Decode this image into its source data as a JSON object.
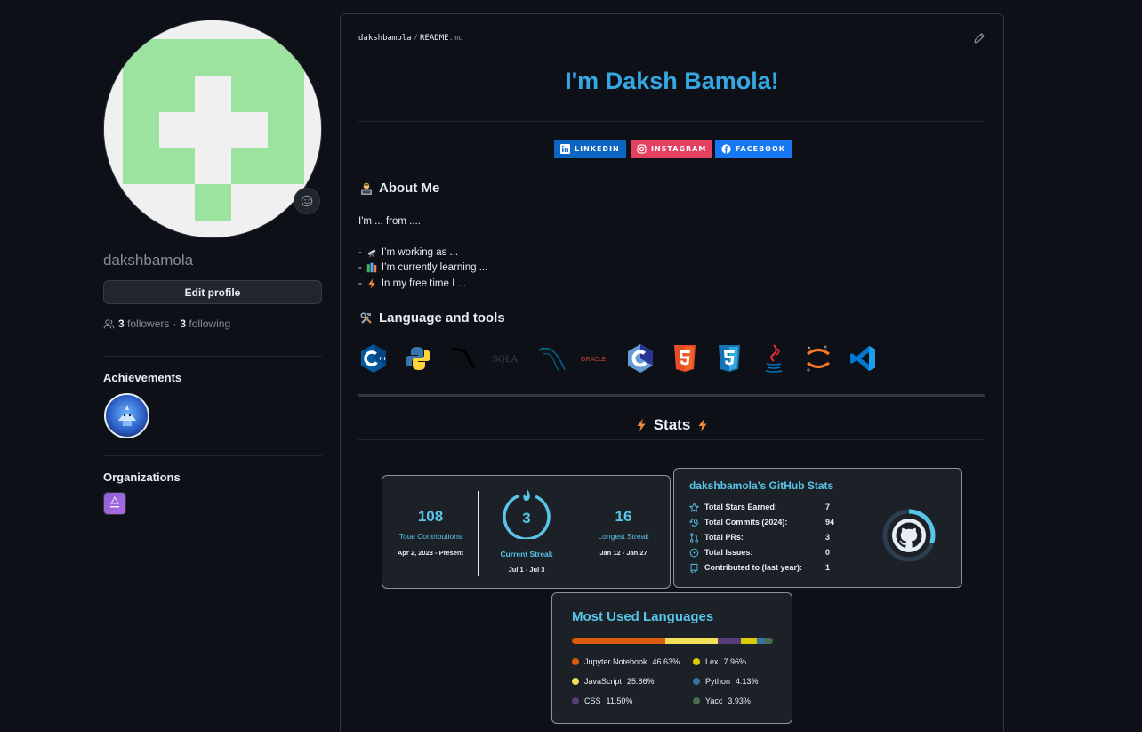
{
  "profile": {
    "username": "dakshbamola",
    "edit_label": "Edit profile",
    "followers_count": "3",
    "followers_label": "followers",
    "separator": "·",
    "following_count": "3",
    "following_label": "following",
    "achievements_heading": "Achievements",
    "organizations_heading": "Organizations"
  },
  "readme": {
    "path_user": "dakshbamola",
    "path_sep": "/",
    "path_file": "README",
    "path_ext": ".md",
    "title": "I'm Daksh Bamola!",
    "social": [
      {
        "label": "LINKEDIN",
        "color": "#0a66c2",
        "icon": "linkedin-icon"
      },
      {
        "label": "INSTAGRAM",
        "color": "#e4405f",
        "icon": "instagram-icon"
      },
      {
        "label": "FACEBOOK",
        "color": "#1877f2",
        "icon": "facebook-icon"
      }
    ],
    "about_heading": "About Me",
    "about_intro": "I'm ... from ....",
    "about_lines": [
      {
        "prefix": "-",
        "text": "I’m working as ...",
        "icon": "telescope-icon"
      },
      {
        "prefix": "-",
        "text": "I’m currently learning ...",
        "icon": "books-icon"
      },
      {
        "prefix": "-",
        "text": "In my free time I ...",
        "icon": "lightning-icon"
      }
    ],
    "tools_heading": "Language and tools",
    "tools": [
      "cplusplus-icon",
      "python-icon",
      "tensorflow-icon",
      "sqlite-icon",
      "mysql-icon",
      "oracle-icon",
      "c-icon",
      "html5-icon",
      "css3-icon",
      "java-icon",
      "jupyter-icon",
      "vscode-icon"
    ],
    "tool_texts": {
      "sqlite": "SQLA",
      "oracle": "ORACLE"
    },
    "stats_heading": "Stats"
  },
  "streak": {
    "total": "108",
    "total_label": "Total Contributions",
    "total_range": "Apr 2, 2023 - Present",
    "current": "3",
    "current_label": "Current Streak",
    "current_range": "Jul 1 - Jul 3",
    "longest": "16",
    "longest_label": "Longest Streak",
    "longest_range": "Jan 12 - Jan 27"
  },
  "github_stats": {
    "title": "dakshbamola's GitHub Stats",
    "rows": [
      {
        "label": "Total Stars Earned:",
        "value": "7",
        "icon": "star-icon"
      },
      {
        "label": "Total Commits (2024):",
        "value": "94",
        "icon": "history-icon"
      },
      {
        "label": "Total PRs:",
        "value": "3",
        "icon": "pull-request-icon"
      },
      {
        "label": "Total Issues:",
        "value": "0",
        "icon": "issue-icon"
      },
      {
        "label": "Contributed to (last year):",
        "value": "1",
        "icon": "repo-icon"
      }
    ],
    "rank_fraction": 0.3
  },
  "languages": {
    "title": "Most Used Languages",
    "items": [
      {
        "name": "Jupyter Notebook",
        "percent": "46.63%",
        "value": 46.63,
        "color": "#DA5B0B"
      },
      {
        "name": "JavaScript",
        "percent": "25.86%",
        "value": 25.86,
        "color": "#f1e05a"
      },
      {
        "name": "CSS",
        "percent": "11.50%",
        "value": 11.5,
        "color": "#563d7c"
      },
      {
        "name": "Lex",
        "percent": "7.96%",
        "value": 7.96,
        "color": "#DBCA00"
      },
      {
        "name": "Python",
        "percent": "4.13%",
        "value": 4.13,
        "color": "#3572A5"
      },
      {
        "name": "Yacc",
        "percent": "3.93%",
        "value": 3.93,
        "color": "#4B6C4B"
      }
    ]
  },
  "colors": {
    "background": "#0d1117",
    "accent": "#58c4e8",
    "title": "#35a8e3",
    "avatar_green": "#9de3a0"
  }
}
